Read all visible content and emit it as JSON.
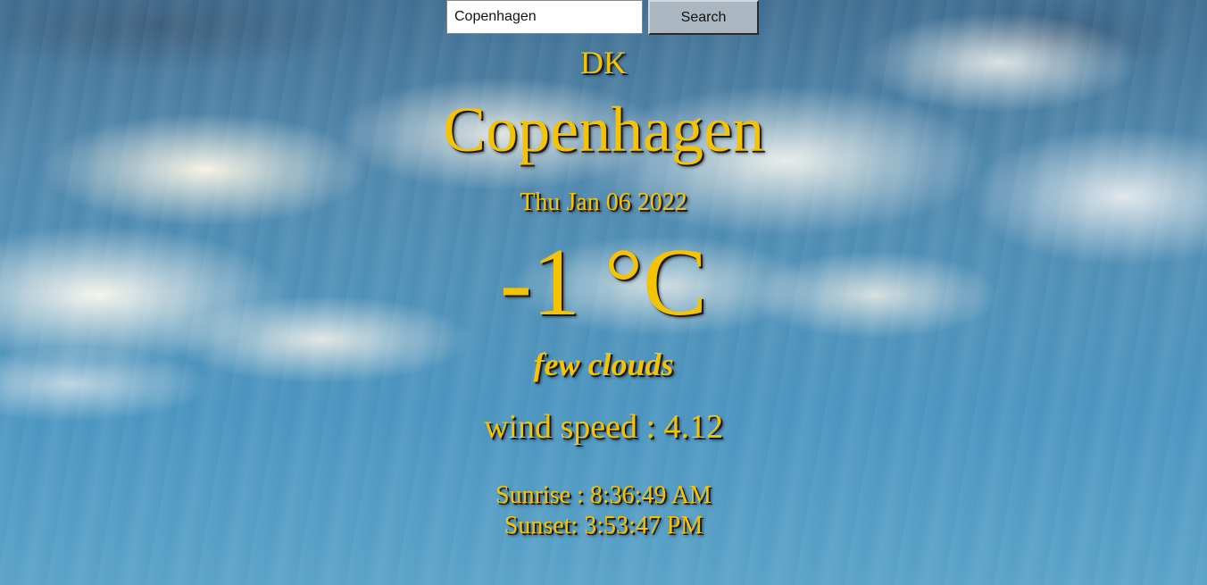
{
  "search": {
    "input_value": "Copenhagen",
    "button_label": "Search"
  },
  "weather": {
    "country": "DK",
    "city": "Copenhagen",
    "date": "Thu Jan 06 2022",
    "temperature": "-1 °C",
    "condition": "few clouds",
    "wind": "wind speed : 4.12",
    "sunrise": "Sunrise : 8:36:49 AM",
    "sunset": "Sunset: 3:53:47 PM"
  },
  "colors": {
    "text_accent": "#f5c400",
    "text_shadow": "#1a1a1a",
    "button_bg": "#aab7c1",
    "sky": "#4f90b8"
  }
}
